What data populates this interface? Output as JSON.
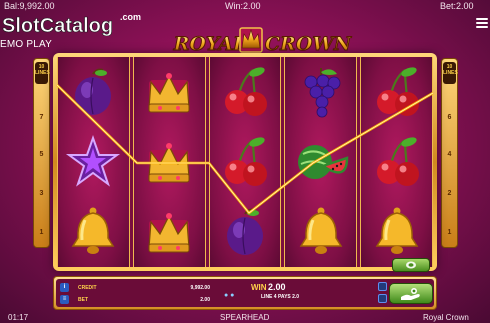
{
  "topbar": {
    "balance": "Bal:9,992.00",
    "win": "Win:2.00",
    "bet": "Bet:2.00"
  },
  "watermark": {
    "brand_text": "SlotCatalog",
    "brand_suffix": ".com",
    "mode": "EMO PLAY"
  },
  "game_logo": {
    "word1": "ROYAL",
    "word2": "CROWN"
  },
  "side_markers": {
    "badge": "10 LINES",
    "left_numbers": [
      "7",
      "5",
      "3",
      "1"
    ],
    "right_numbers": [
      "6",
      "4",
      "2",
      "1"
    ]
  },
  "reels": [
    [
      "plum",
      "star",
      "bell"
    ],
    [
      "crown",
      "crown",
      "crown"
    ],
    [
      "cherry",
      "cherry",
      "plum"
    ],
    [
      "grapes",
      "watermelon",
      "bell"
    ],
    [
      "cherry",
      "cherry",
      "bell"
    ]
  ],
  "panel": {
    "credit_label": "CREDIT",
    "credit_value": "9,992.00",
    "bet_label": "BET",
    "bet_value": "2.00",
    "win_label": "WIN",
    "win_value": "2.00",
    "pays_text": "LINE 4 PAYS 2.0"
  },
  "footer": {
    "time": "01:17",
    "provider": "SPEARHEAD",
    "game_title": "Royal Crown"
  },
  "colors": {
    "background": "#8e1157",
    "frame_gold": "#d18a1f",
    "win_line": "#ffb400",
    "button_green": "#4a8f1f"
  }
}
